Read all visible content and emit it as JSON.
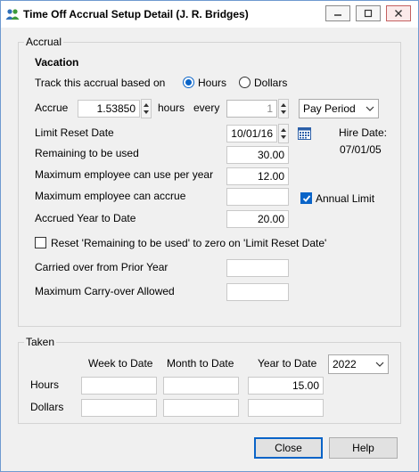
{
  "window": {
    "title": "Time Off Accrual Setup Detail (J. R. Bridges)"
  },
  "accrual": {
    "group_label": "Accrual",
    "type_heading": "Vacation",
    "based_on_label": "Track this accrual based on",
    "hours_option": "Hours",
    "dollars_option": "Dollars",
    "based_on_selected": "Hours",
    "accrue_label": "Accrue",
    "accrue_value": "1.53850",
    "hours_unit": "hours",
    "every_label": "every",
    "every_value": "1",
    "period_value": "Pay Period",
    "limit_reset_label": "Limit Reset Date",
    "limit_reset_value": "10/01/16",
    "hire_date_label": "Hire Date:",
    "hire_date_value": "07/01/05",
    "remaining_label": "Remaining to be used",
    "remaining_value": "30.00",
    "max_use_label": "Maximum employee can use per year",
    "max_use_value": "12.00",
    "max_accrue_label": "Maximum employee can accrue",
    "max_accrue_value": "",
    "annual_limit_label": "Annual Limit",
    "annual_limit_checked": true,
    "accrued_ytd_label": "Accrued Year to Date",
    "accrued_ytd_value": "20.00",
    "reset_label": "Reset 'Remaining to be used' to zero on 'Limit Reset Date'",
    "reset_checked": false,
    "carried_over_label": "Carried over from Prior Year",
    "carried_over_value": "",
    "max_carryover_label": "Maximum Carry-over Allowed",
    "max_carryover_value": ""
  },
  "taken": {
    "group_label": "Taken",
    "col_week": "Week to Date",
    "col_month": "Month to Date",
    "col_year": "Year to Date",
    "year_value": "2022",
    "row_hours": "Hours",
    "row_dollars": "Dollars",
    "hours_week": "",
    "hours_month": "",
    "hours_year": "15.00",
    "dollars_week": "",
    "dollars_month": "",
    "dollars_year": ""
  },
  "buttons": {
    "close": "Close",
    "help": "Help"
  },
  "colors": {
    "accent": "#0a64c8",
    "window_bg": "#f0f0f0",
    "border": "#6f9ad0"
  },
  "icons": {
    "app": "people-icon",
    "calendar": "calendar-icon"
  }
}
